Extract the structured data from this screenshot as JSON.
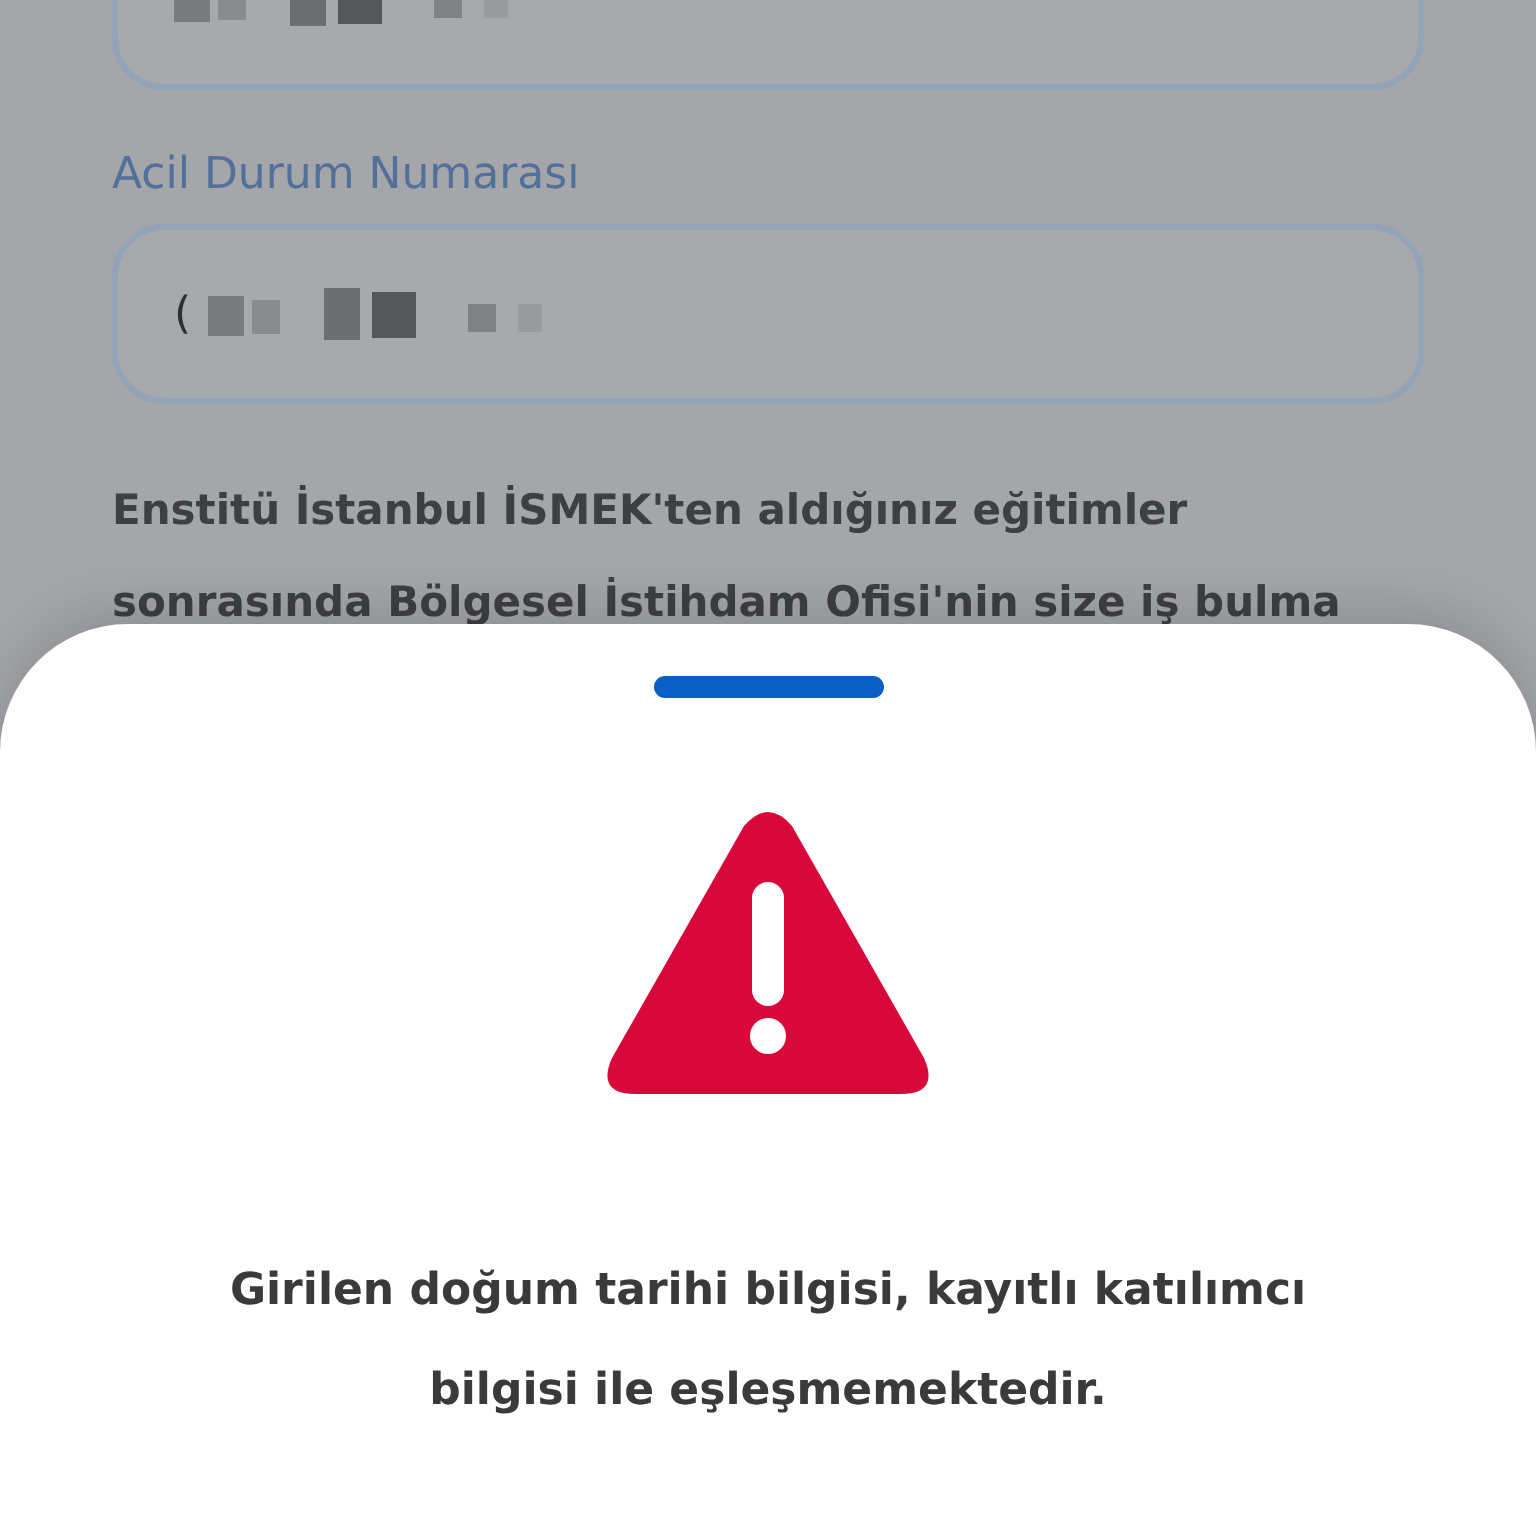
{
  "form": {
    "fields": [
      {
        "redacted": true
      },
      {
        "label": "Acil Durum Numarası",
        "prefix": "(",
        "redacted": true
      }
    ],
    "notice": "Enstitü İstanbul İSMEK'ten aldığınız eğitimler sonrasında Bölgesel İstihdam Ofisi'nin size iş bulma"
  },
  "sheet": {
    "kind": "error",
    "message": "Girilen doğum tarihi bilgisi, kayıtlı katılımcı bilgisi ile eşleşmemektedir."
  }
}
